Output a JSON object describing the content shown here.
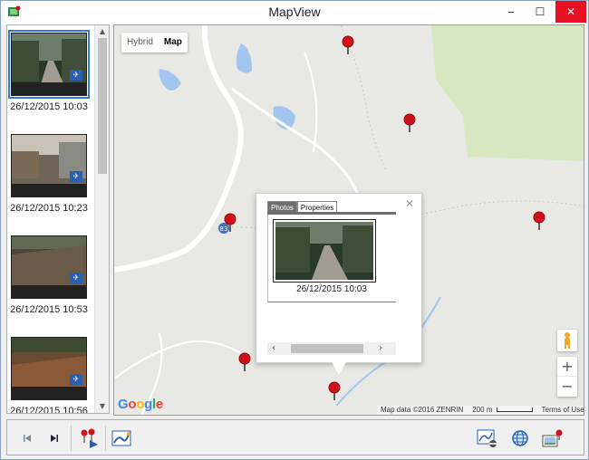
{
  "window": {
    "title": "MapView",
    "minimize_glyph": "‒",
    "maximize_glyph": "☐",
    "close_glyph": "✕"
  },
  "thumbnails": [
    {
      "timestamp": "26/12/2015 10:03",
      "selected": true,
      "icon": "gps-tag-icon"
    },
    {
      "timestamp": "26/12/2015 10:23",
      "selected": false,
      "icon": "gps-tag-icon"
    },
    {
      "timestamp": "26/12/2015 10:53",
      "selected": false,
      "icon": "gps-tag-icon"
    },
    {
      "timestamp": "26/12/2015 10:56",
      "selected": false,
      "icon": "gps-tag-icon"
    }
  ],
  "map": {
    "type_buttons": [
      {
        "label": "Hybrid",
        "active": false
      },
      {
        "label": "Map",
        "active": true
      }
    ],
    "route_shield": "83",
    "logo": "Google",
    "attribution": "Map data ©2016 ZENRIN",
    "scale": "200 m",
    "terms": "Terms of Use",
    "zoom_in": "+",
    "zoom_out": "−"
  },
  "popup": {
    "tabs": [
      {
        "label": "Photos",
        "active": true
      },
      {
        "label": "Properties",
        "active": false
      }
    ],
    "close_glyph": "✕",
    "caption": "26/12/2015 10:03",
    "scroll_left": "‹",
    "scroll_right": "›"
  },
  "colors": {
    "marker": "#d2101a",
    "road": "#ffffff",
    "water": "#a3c6f0",
    "park": "#d6e8c0",
    "selection": "#3377dd",
    "close_button": "#e81123"
  }
}
